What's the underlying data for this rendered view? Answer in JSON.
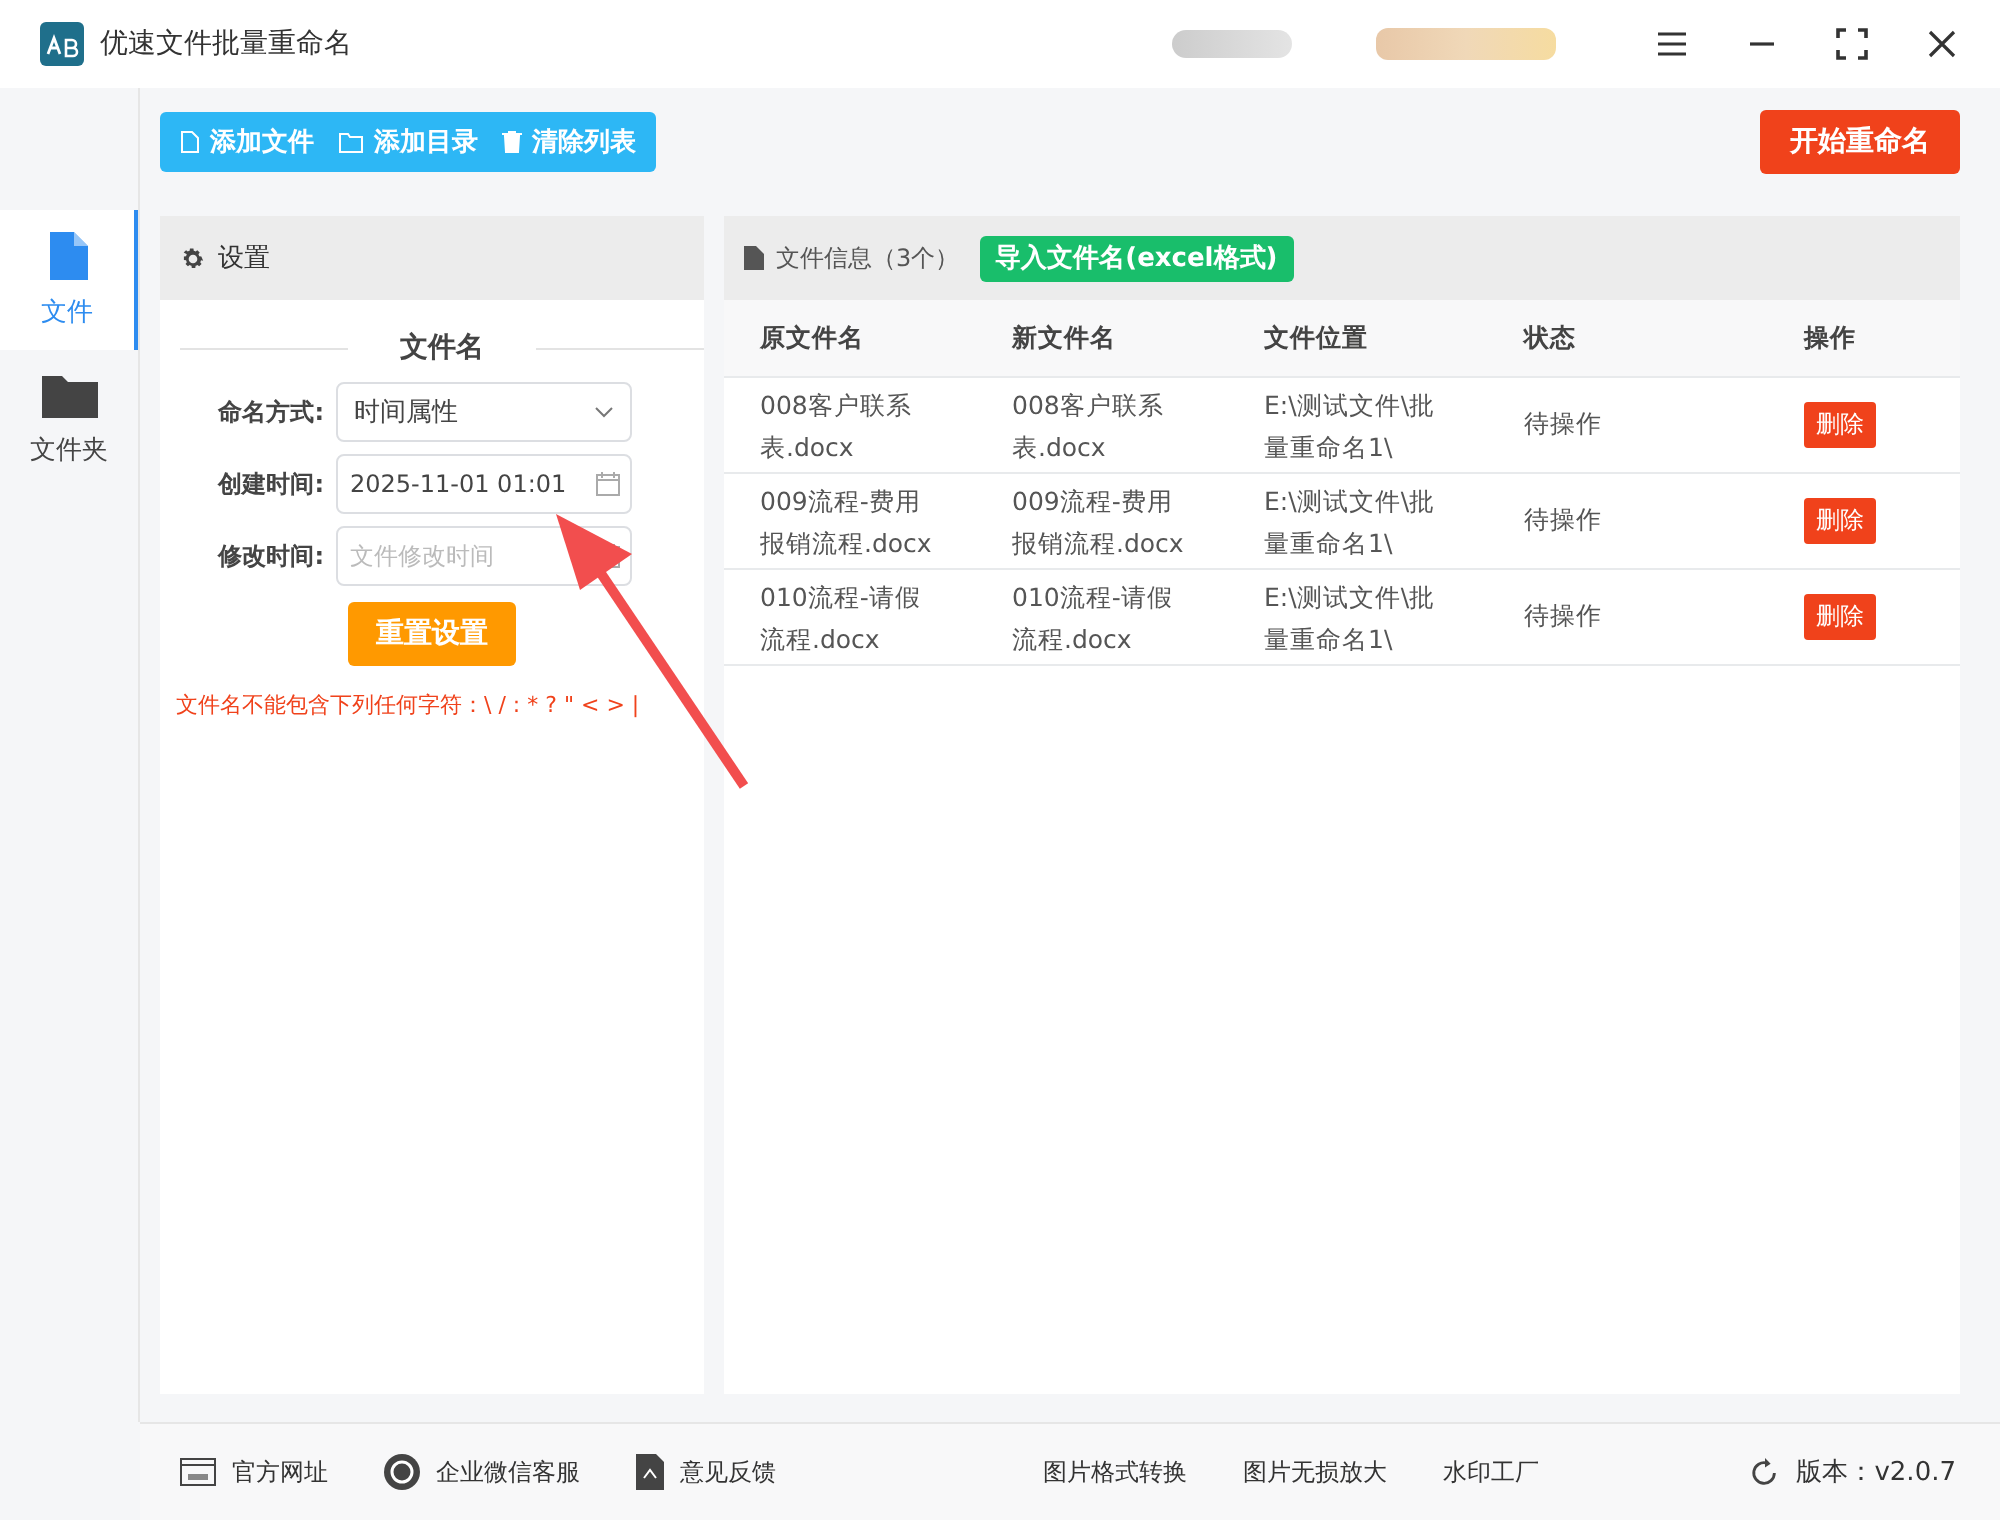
{
  "window": {
    "title": "优速文件批量重命名"
  },
  "sidebar": {
    "items": [
      {
        "label": "文件",
        "selected": true
      },
      {
        "label": "文件夹",
        "selected": false
      }
    ]
  },
  "toolbar": {
    "buttons": [
      "添加文件",
      "添加目录",
      "清除列表"
    ],
    "start_button": "开始重命名"
  },
  "settings": {
    "title": "设置",
    "section": "文件名",
    "fields": [
      {
        "label": "命名方式:",
        "kind": "select",
        "value": "时间属性"
      },
      {
        "label": "创建时间:",
        "kind": "date",
        "value": "2025-11-01 01:01"
      },
      {
        "label": "修改时间:",
        "kind": "date",
        "placeholder": "文件修改时间"
      }
    ],
    "reset_button": "重置设置",
    "warning": "文件名不能包含下列任何字符：\\ / : * ? \" < > |"
  },
  "files": {
    "title": "文件信息（3个）",
    "import_button": "导入文件名(excel格式)",
    "columns": [
      "原文件名",
      "新文件名",
      "文件位置",
      "状态",
      "操作"
    ],
    "rows": [
      {
        "original": "008客户联系表.docx",
        "new": "008客户联系表.docx",
        "location": "E:\\测试文件\\批量重命名1\\",
        "status": "待操作",
        "action": "删除"
      },
      {
        "original": "009流程-费用报销流程.docx",
        "new": "009流程-费用报销流程.docx",
        "location": "E:\\测试文件\\批量重命名1\\",
        "status": "待操作",
        "action": "删除"
      },
      {
        "original": "010流程-请假流程.docx",
        "new": "010流程-请假流程.docx",
        "location": "E:\\测试文件\\批量重命名1\\",
        "status": "待操作",
        "action": "删除"
      }
    ]
  },
  "footer": {
    "left": [
      "官方网址",
      "企业微信客服",
      "意见反馈"
    ],
    "center": [
      "图片格式转换",
      "图片无损放大",
      "水印工厂"
    ],
    "version": "版本：v2.0.7"
  }
}
